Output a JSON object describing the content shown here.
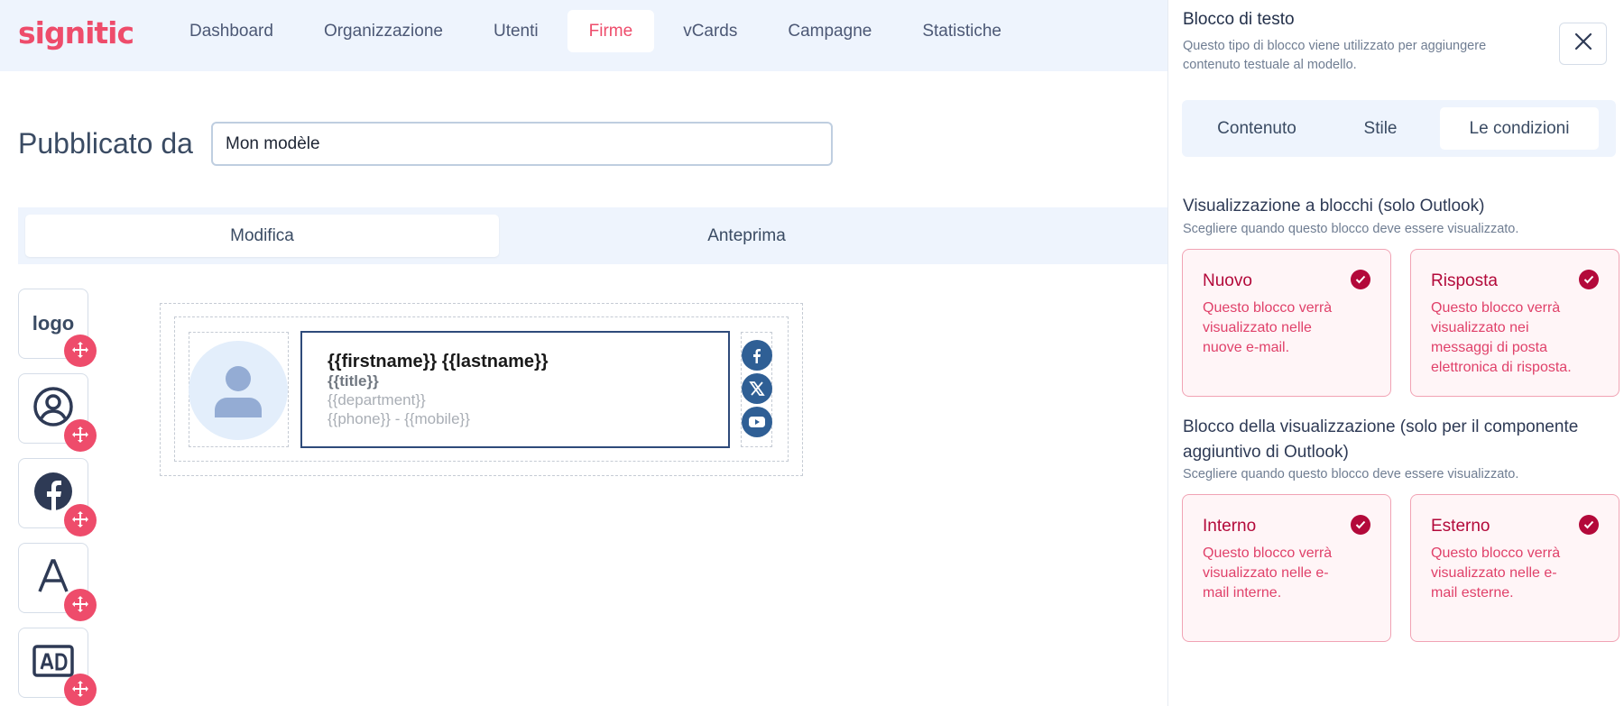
{
  "brand": {
    "name": "signitic",
    "color": "#ee4c6b"
  },
  "nav": {
    "items": [
      {
        "label": "Dashboard",
        "active": false
      },
      {
        "label": "Organizzazione",
        "active": false
      },
      {
        "label": "Utenti",
        "active": false
      },
      {
        "label": "Firme",
        "active": true
      },
      {
        "label": "vCards",
        "active": false
      },
      {
        "label": "Campagne",
        "active": false
      },
      {
        "label": "Statistiche",
        "active": false
      }
    ]
  },
  "header": {
    "label": "Pubblicato da",
    "input_value": "Mon modèle"
  },
  "mode_tabs": [
    {
      "label": "Modifica",
      "active": true
    },
    {
      "label": "Anteprima",
      "active": false
    }
  ],
  "palette": {
    "items": [
      {
        "label": "logo",
        "icon": "logo-text"
      },
      {
        "icon": "user-circle-icon"
      },
      {
        "icon": "facebook-icon"
      },
      {
        "icon": "font-icon"
      },
      {
        "icon": "ad-icon"
      }
    ],
    "drag_icon": "move-icon"
  },
  "signature": {
    "name_line": "{{firstname}} {{lastname}}",
    "title_line": "{{title}}",
    "department_line": "{{department}}",
    "phone_line": "{{phone}} - {{mobile}}",
    "socials": [
      "facebook-icon",
      "x-icon",
      "youtube-icon"
    ]
  },
  "panel": {
    "title": "Blocco di testo",
    "description": "Questo tipo di blocco viene utilizzato per aggiungere contenuto testuale al modello.",
    "tabs": [
      {
        "label": "Contenuto",
        "active": false
      },
      {
        "label": "Stile",
        "active": false
      },
      {
        "label": "Le condizioni",
        "active": true
      }
    ],
    "section1": {
      "title": "Visualizzazione a blocchi (solo Outlook)",
      "subtitle": "Scegliere quando questo blocco deve essere visualizzato.",
      "cards": [
        {
          "title": "Nuovo",
          "description": "Questo blocco verrà visualizzato nelle nuove e-mail.",
          "checked": true
        },
        {
          "title": "Risposta",
          "description": "Questo blocco verrà visualizzato nei messaggi di posta elettronica di risposta.",
          "checked": true
        }
      ]
    },
    "section2": {
      "title": "Blocco della visualizzazione (solo per il componente aggiuntivo di Outlook)",
      "subtitle": "Scegliere quando questo blocco deve essere visualizzato.",
      "cards": [
        {
          "title": "Interno",
          "description": "Questo blocco verrà visualizzato nelle e-mail interne.",
          "checked": true
        },
        {
          "title": "Esterno",
          "description": "Questo blocco verrà visualizzato nelle e-mail esterne.",
          "checked": true
        }
      ]
    }
  },
  "colors": {
    "accent": "#ee4c6b",
    "card_accent": "#b3093a",
    "social": "#2f5f95",
    "nav_bg": "#eef4fd"
  }
}
